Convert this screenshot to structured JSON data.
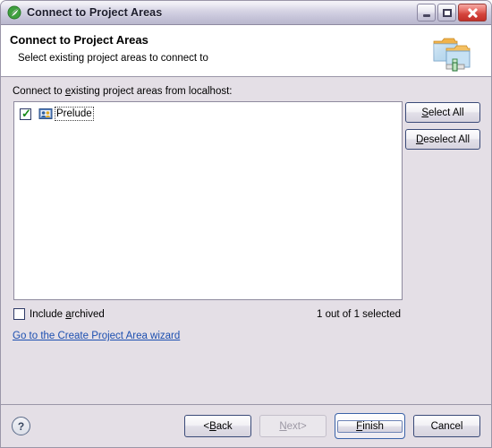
{
  "window": {
    "title": "Connect to Project Areas",
    "title_icon": "jazz-leaf-icon",
    "controls": {
      "minimize": "Minimize",
      "maximize": "Maximize",
      "close": "Close"
    }
  },
  "header": {
    "title": "Connect to Project Areas",
    "subtitle": "Select existing project areas to connect to",
    "icon": "connect-project-areas-banner-icon"
  },
  "body": {
    "prompt_before": "Connect to ",
    "prompt_mnemonic": "e",
    "prompt_after": "xisting project areas from localhost:",
    "tree": {
      "items": [
        {
          "label": "Prelude",
          "checked": true,
          "focused": true,
          "icon": "project-area-icon"
        }
      ]
    },
    "side_buttons": [
      {
        "mnemonic": "S",
        "rest": "elect All",
        "name": "select-all-button"
      },
      {
        "mnemonic": "D",
        "rest": "eselect All",
        "name": "deselect-all-button"
      }
    ],
    "include_archived": {
      "label_before": "Include ",
      "label_mnemonic": "a",
      "label_after": "rchived",
      "checked": false
    },
    "status": "1 out of 1 selected",
    "wizard_link": "Go to the Create Project Area wizard"
  },
  "footer": {
    "help_icon": "help-icon",
    "help_glyph": "?",
    "buttons": [
      {
        "prefix": "< ",
        "mnemonic": "B",
        "rest": "ack",
        "suffix": "",
        "state": "enabled",
        "default": false
      },
      {
        "prefix": "",
        "mnemonic": "N",
        "rest": "ext",
        "suffix": " >",
        "state": "disabled",
        "default": false
      },
      {
        "prefix": "",
        "mnemonic": "F",
        "rest": "inish",
        "suffix": "",
        "state": "enabled",
        "default": true
      },
      {
        "prefix": "",
        "mnemonic": "",
        "rest": "Cancel",
        "suffix": "",
        "state": "enabled",
        "default": false
      }
    ]
  },
  "colors": {
    "titlebar_top": "#f4f3f8",
    "titlebar_bottom": "#b9b7cd",
    "body_bg": "#e4dfe6",
    "header_bg": "#ffffff",
    "border": "#9a96a8",
    "link": "#1c4fb0",
    "check_green": "#178a17",
    "close_red": "#d4443c",
    "default_button_border": "#3a62a8"
  }
}
